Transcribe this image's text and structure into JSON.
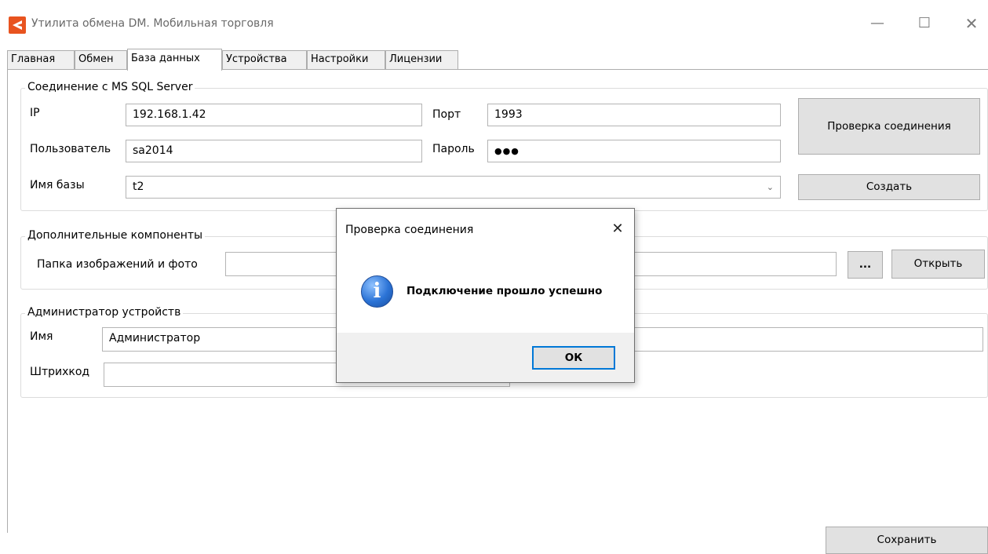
{
  "window": {
    "title": "Утилита обмена DM. Мобильная торговля",
    "min_glyph": "—",
    "max_glyph": "☐",
    "close_glyph": "✕",
    "accent_color": "#e8531f"
  },
  "tabs": [
    {
      "label": "Главная"
    },
    {
      "label": "Обмен"
    },
    {
      "label": "База данных",
      "active": true
    },
    {
      "label": "Устройства"
    },
    {
      "label": "Настройки"
    },
    {
      "label": "Лицензии"
    }
  ],
  "sql_group": {
    "title": "Соединение с MS SQL Server",
    "ip_label": "IP",
    "ip_value": "192.168.1.42",
    "port_label": "Порт",
    "port_value": "1993",
    "user_label": "Пользователь",
    "user_value": "sa2014",
    "password_label": "Пароль",
    "password_value": "●●●",
    "dbname_label": "Имя базы",
    "dbname_value": "t2",
    "check_button": "Проверка соединения",
    "create_button": "Создать"
  },
  "extra_group": {
    "title": "Дополнительные компоненты",
    "folder_label": "Папка изображений и фото",
    "folder_value": "",
    "browse_button": "...",
    "open_button": "Открыть"
  },
  "admin_group": {
    "title": "Администратор устройств",
    "name_label": "Имя",
    "name_value": "Администратор",
    "barcode_label": "Штрихкод",
    "barcode_value": ""
  },
  "save_button": "Сохранить",
  "dialog": {
    "title": "Проверка соединения",
    "message": "Подключение прошло успешно",
    "ok_button": "ОК",
    "close_glyph": "✕",
    "info_glyph": "i"
  }
}
